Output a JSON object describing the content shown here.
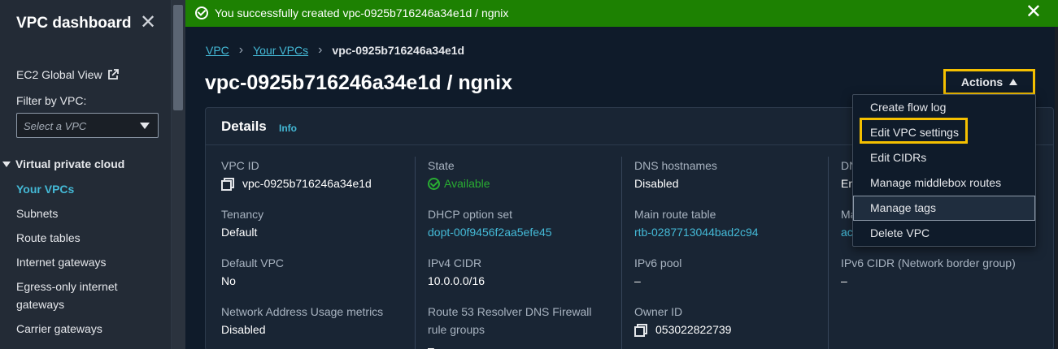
{
  "sidebar": {
    "title": "VPC dashboard",
    "close_icon": "close-icon",
    "ec2_global_view": "EC2 Global View",
    "filter_label": "Filter by VPC:",
    "filter_placeholder": "Select a VPC",
    "section": "Virtual private cloud",
    "items": [
      {
        "label": "Your VPCs",
        "active": true
      },
      {
        "label": "Subnets"
      },
      {
        "label": "Route tables"
      },
      {
        "label": "Internet gateways"
      },
      {
        "label": "Egress-only internet gateways"
      },
      {
        "label": "Carrier gateways"
      }
    ]
  },
  "flash": {
    "message": "You successfully created vpc-0925b716246a34e1d / ngnix",
    "color": "#1d8102"
  },
  "breadcrumb": {
    "root": "VPC",
    "parent": "Your VPCs",
    "current": "vpc-0925b716246a34e1d"
  },
  "page": {
    "title": "vpc-0925b716246a34e1d / ngnix"
  },
  "actions": {
    "label": "Actions",
    "menu": [
      "Create flow log",
      "Edit VPC settings",
      "Edit CIDRs",
      "Manage middlebox routes",
      "Manage tags",
      "Delete VPC"
    ]
  },
  "details": {
    "title": "Details",
    "info": "Info",
    "col1": {
      "vpc_id_label": "VPC ID",
      "vpc_id_value": "vpc-0925b716246a34e1d",
      "tenancy_label": "Tenancy",
      "tenancy_value": "Default",
      "default_vpc_label": "Default VPC",
      "default_vpc_value": "No",
      "nau_label": "Network Address Usage metrics",
      "nau_value": "Disabled"
    },
    "col2": {
      "state_label": "State",
      "state_value": "Available",
      "dhcp_label": "DHCP option set",
      "dhcp_value": "dopt-00f9456f2aa5efe45",
      "ipv4_label": "IPv4 CIDR",
      "ipv4_value": "10.0.0.0/16",
      "r53_label_1": "Route 53 Resolver DNS Firewall",
      "r53_label_2": "rule groups",
      "r53_value": "–"
    },
    "col3": {
      "dns_hostnames_label": "DNS hostnames",
      "dns_hostnames_value": "Disabled",
      "main_rt_label": "Main route table",
      "main_rt_value": "rtb-0287713044bad2c94",
      "ipv6_pool_label": "IPv6 pool",
      "ipv6_pool_value": "–",
      "owner_label": "Owner ID",
      "owner_value": "053022822739"
    },
    "col4": {
      "dns_label_partial": "DN",
      "dns_value_partial": "En",
      "ma_label_partial": "Ma",
      "ma_value_partial": "acl",
      "ipv6_cidr_label": "IPv6 CIDR (Network border group)",
      "ipv6_cidr_value": "–"
    }
  }
}
